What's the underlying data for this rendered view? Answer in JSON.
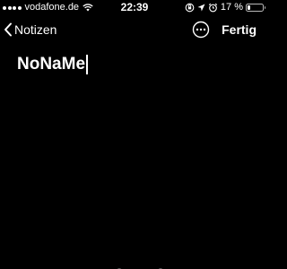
{
  "status_bar": {
    "carrier": "vodafone.de",
    "time": "22:39",
    "battery_percent": "17 %",
    "battery_level": 0.17,
    "icons": [
      "signal-icon",
      "wifi-icon",
      "orientation-lock-icon",
      "location-icon",
      "alarm-icon",
      "battery-icon"
    ]
  },
  "nav_bar": {
    "back_label": "Notizen",
    "done_label": "Fertig",
    "more_icon": "more-icon"
  },
  "note": {
    "text": "NoNaMe"
  },
  "colors": {
    "background": "#000000",
    "text": "#ffffff",
    "accent": "#ffffff"
  }
}
